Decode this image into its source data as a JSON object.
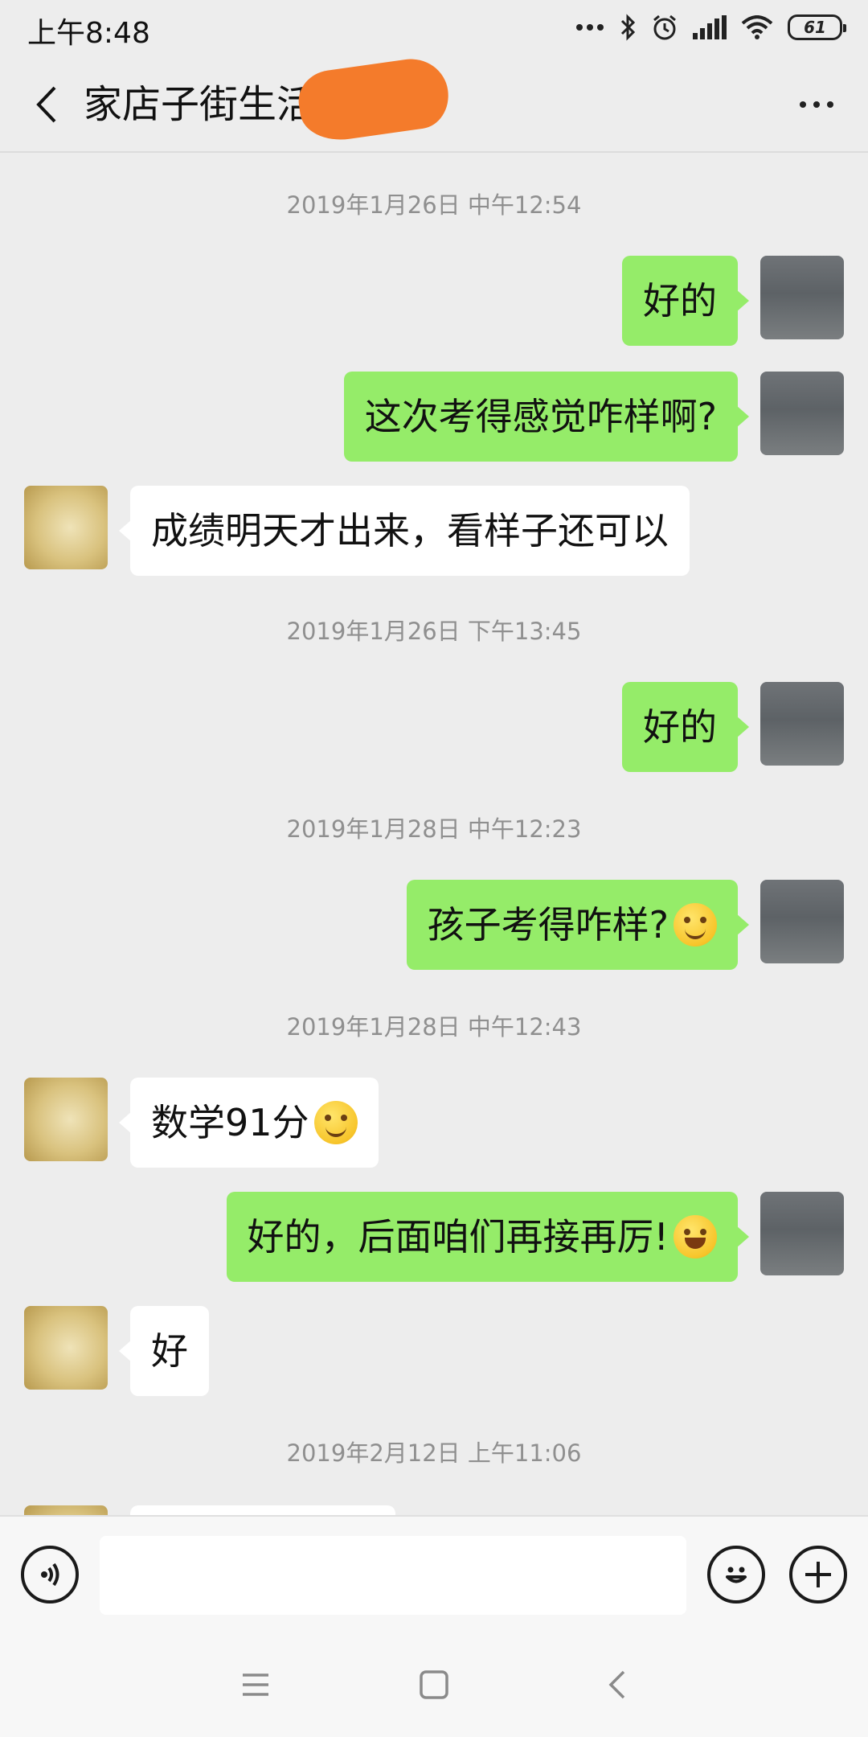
{
  "status_bar": {
    "time": "上午8:48",
    "battery": "61",
    "icons": [
      "more-dots-icon",
      "bluetooth-icon",
      "alarm-icon",
      "signal-icon",
      "wifi-icon",
      "battery-icon"
    ]
  },
  "header": {
    "title": "家店子街生活",
    "back_icon": "back-chevron-icon",
    "more_icon": "more-icon"
  },
  "messages": [
    {
      "type": "time",
      "text": "2019年1月26日 中午12:54"
    },
    {
      "type": "msg",
      "side": "self",
      "text": "好的"
    },
    {
      "type": "msg",
      "side": "self",
      "text": "这次考得感觉咋样啊?"
    },
    {
      "type": "msg",
      "side": "other",
      "text": "成绩明天才出来，看样子还可以"
    },
    {
      "type": "time",
      "text": "2019年1月26日 下午13:45"
    },
    {
      "type": "msg",
      "side": "self",
      "text": "好的"
    },
    {
      "type": "time",
      "text": "2019年1月28日 中午12:23"
    },
    {
      "type": "msg",
      "side": "self",
      "text": "孩子考得咋样?",
      "emoji": "smile-emoji"
    },
    {
      "type": "time",
      "text": "2019年1月28日 中午12:43"
    },
    {
      "type": "msg",
      "side": "other",
      "text": "数学91分",
      "emoji": "smile-emoji"
    },
    {
      "type": "msg",
      "side": "self",
      "text": "好的，后面咱们再接再厉!",
      "emoji": "grin-emoji"
    },
    {
      "type": "msg",
      "side": "other",
      "text": "好"
    },
    {
      "type": "time",
      "text": "2019年2月12日 上午11:06"
    }
  ],
  "input_bar": {
    "voice_icon": "voice-icon",
    "placeholder": "",
    "emoji_icon": "emoji-icon",
    "plus_icon": "plus-icon"
  },
  "system_nav": {
    "icons": [
      "menu-icon",
      "home-icon",
      "back-icon"
    ]
  },
  "colors": {
    "background": "#ededed",
    "self_bubble": "#95ec69",
    "other_bubble": "#ffffff",
    "redaction": "#f47b2b"
  }
}
